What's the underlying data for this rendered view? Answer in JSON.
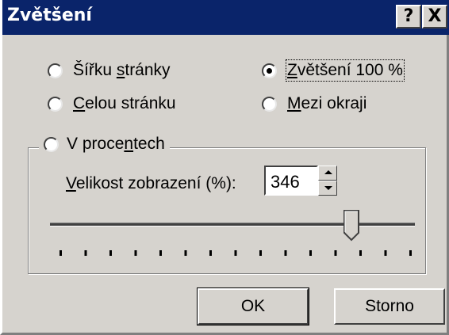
{
  "window": {
    "title": "Zvětšení",
    "help_label": "?",
    "close_label": "X"
  },
  "options": [
    {
      "id": "page-width",
      "label": "Šířku stránky",
      "checked": false
    },
    {
      "id": "zoom-100",
      "label": "Zvětšení 100 %",
      "checked": true
    },
    {
      "id": "whole-page",
      "label": "Celou stránku",
      "checked": false
    },
    {
      "id": "between-margins",
      "label": "Mezi okraji",
      "checked": false
    },
    {
      "id": "percent",
      "label": "V procentech",
      "checked": false
    }
  ],
  "percent_group": {
    "size_label": "Velikost zobrazení (%):",
    "size_value": "346",
    "slider_position_fraction": 0.85,
    "tick_count": 15
  },
  "buttons": {
    "ok_label": "OK",
    "cancel_label": "Storno"
  }
}
